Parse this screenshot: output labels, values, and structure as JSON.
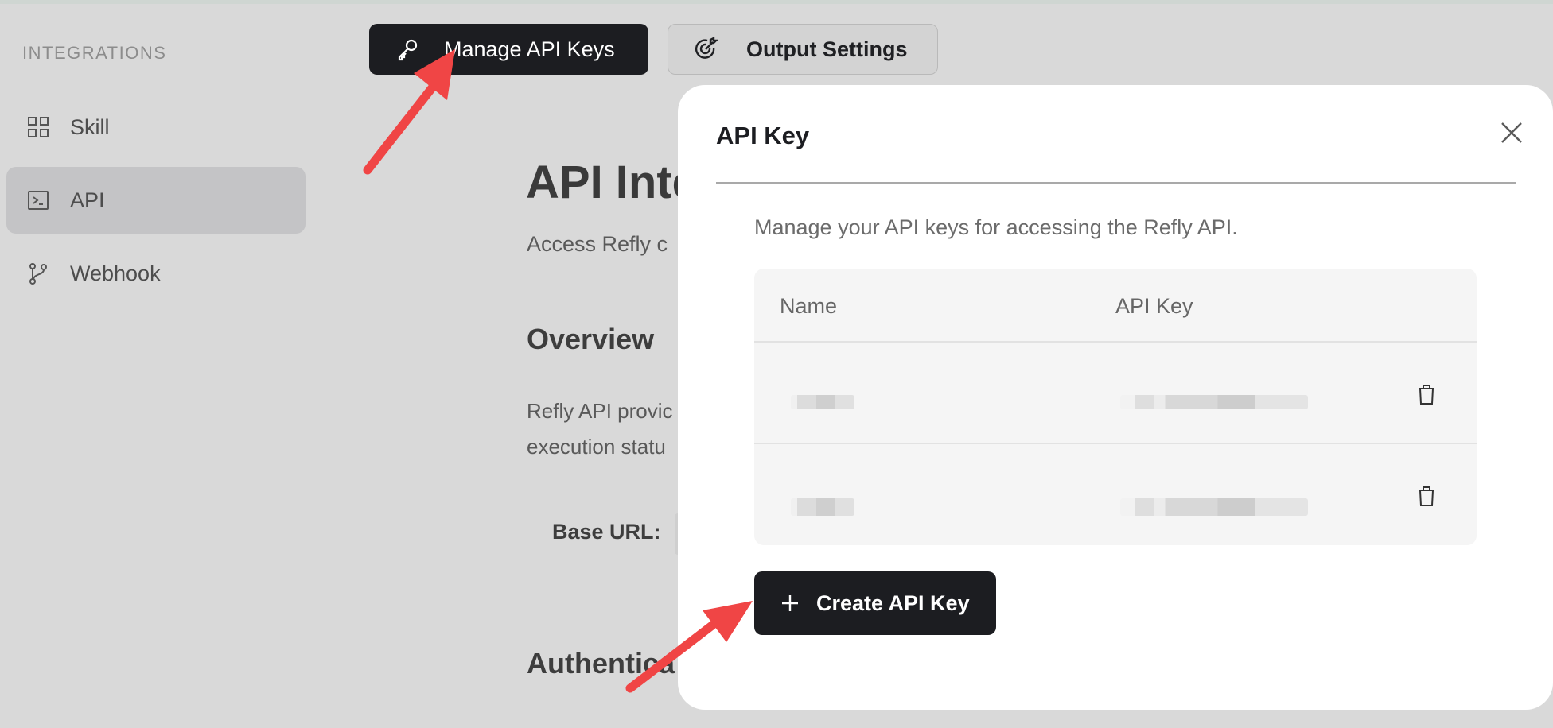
{
  "sidebar": {
    "heading": "INTEGRATIONS",
    "items": [
      {
        "label": "Skill",
        "icon": "grid-icon",
        "active": false
      },
      {
        "label": "API",
        "icon": "terminal-icon",
        "active": true
      },
      {
        "label": "Webhook",
        "icon": "git-branch-icon",
        "active": false
      }
    ]
  },
  "toolbar": {
    "manage_label": "Manage API Keys",
    "manage_icon": "key-icon",
    "output_label": "Output Settings",
    "output_icon": "target-arrow-icon"
  },
  "page": {
    "title": "API Inte",
    "subtitle": "Access Refly c",
    "overview_heading": "Overview",
    "overview_line1": "Refly API provic",
    "overview_line2": "execution statu",
    "base_url_label": "Base URL:",
    "auth_heading": "Authentica"
  },
  "modal": {
    "title": "API Key",
    "description": "Manage your API keys for accessing the Refly API.",
    "table": {
      "headers": [
        "Name",
        "API Key"
      ],
      "rows": [
        {
          "name": "",
          "key": ""
        },
        {
          "name": "",
          "key": ""
        }
      ]
    },
    "create_label": "Create API Key"
  },
  "colors": {
    "primary_button": "#1c1d21",
    "annotation_arrow": "#f04545",
    "overlay_bg": "#d9d9d9"
  }
}
